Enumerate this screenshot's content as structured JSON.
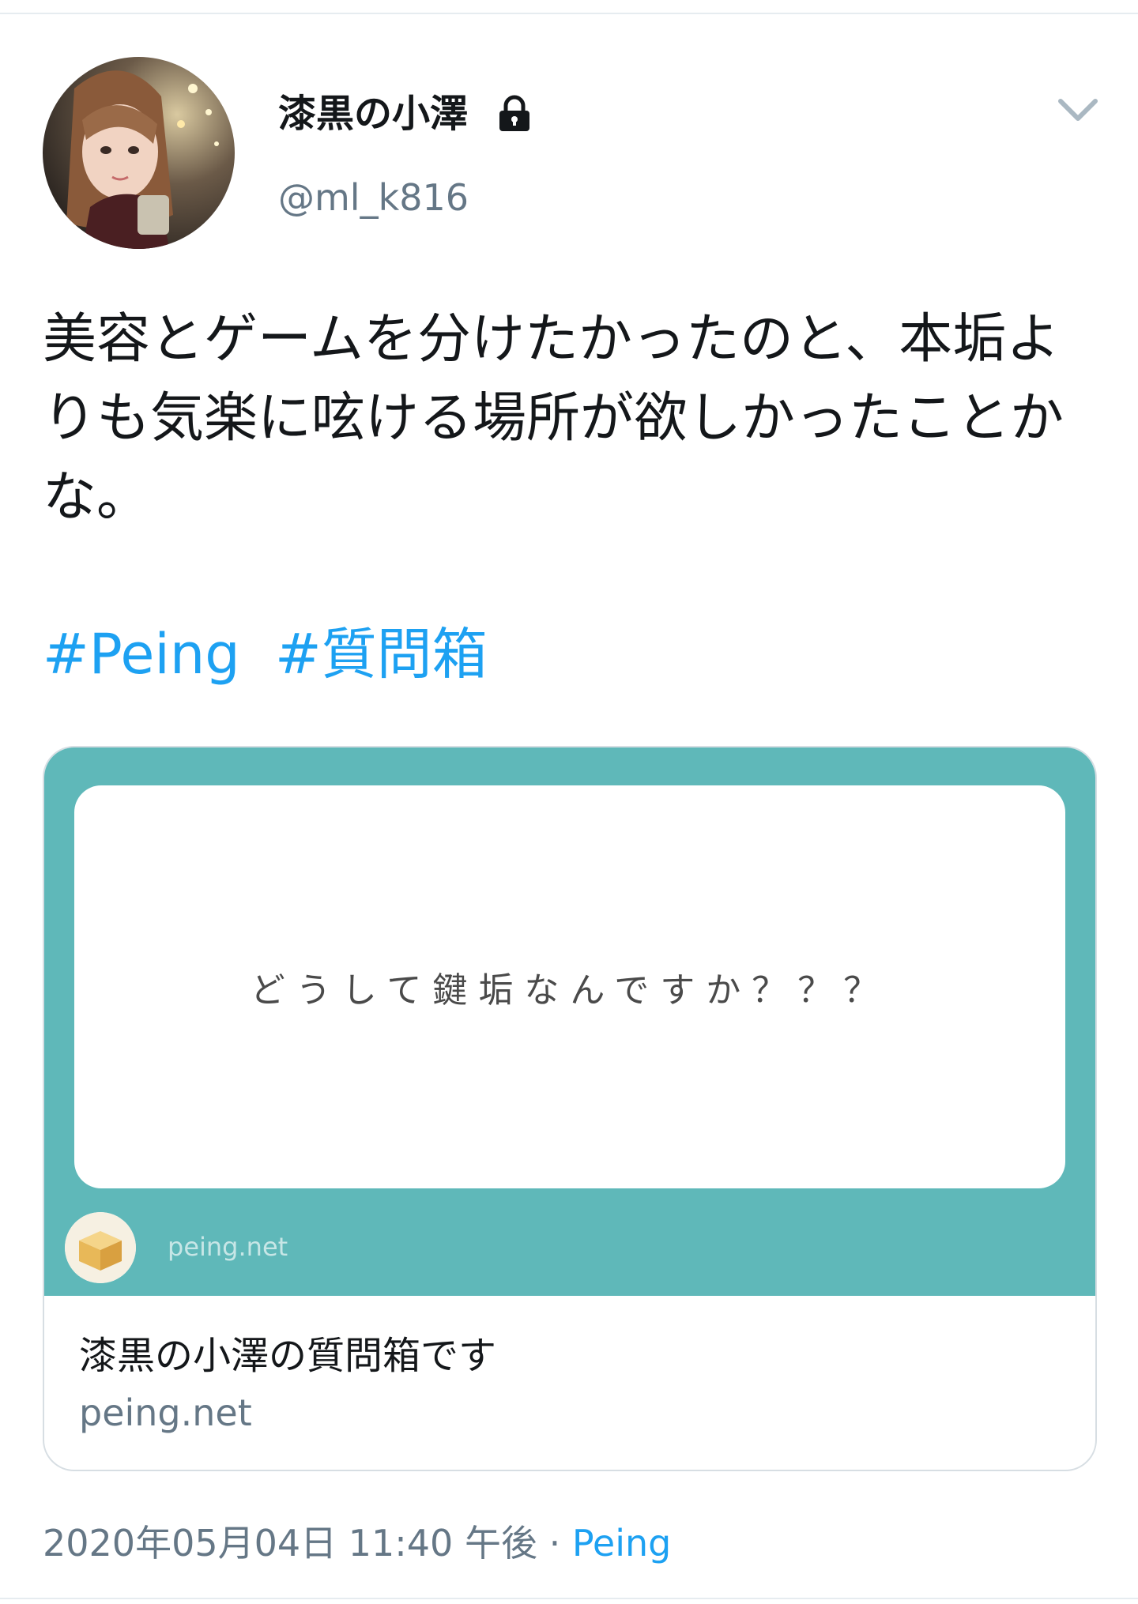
{
  "tweet": {
    "author": {
      "display_name": "漆黒の小澤",
      "handle": "@ml_k816",
      "protected_icon": "lock-icon"
    },
    "menu_icon": "chevron-down-icon",
    "text": "美容とゲームを分けたかったのと、本垢よりも気楽に呟ける場所が欲しかったことかな。",
    "hashtags": [
      "#Peing",
      "#質問箱"
    ],
    "card": {
      "image_question": "どうして鍵垢なんですか？？？",
      "image_domain": "peing.net",
      "title": "漆黒の小澤の質問箱です",
      "domain": "peing.net"
    },
    "timestamp": "2020年05月04日 11:40 午後",
    "separator": " · ",
    "source": "Peing"
  },
  "colors": {
    "link": "#1da1f2",
    "secondary_text": "#657786",
    "card_teal": "#5fb8b9",
    "border": "#d7dee3"
  }
}
